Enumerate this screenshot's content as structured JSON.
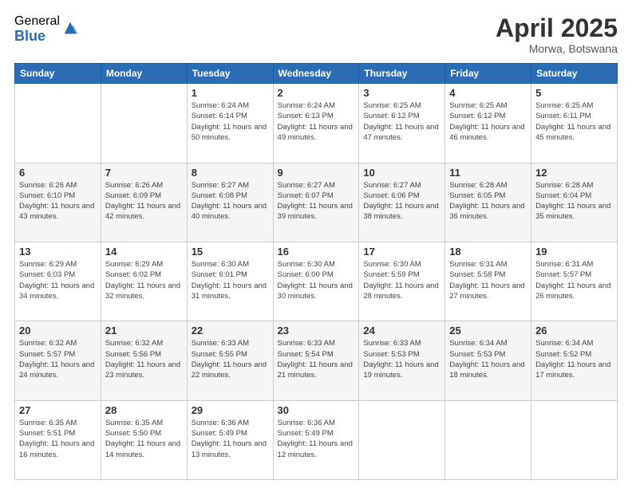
{
  "logo": {
    "general": "General",
    "blue": "Blue"
  },
  "title": "April 2025",
  "location": "Morwa, Botswana",
  "weekdays": [
    "Sunday",
    "Monday",
    "Tuesday",
    "Wednesday",
    "Thursday",
    "Friday",
    "Saturday"
  ],
  "weeks": [
    [
      {
        "day": "",
        "info": ""
      },
      {
        "day": "",
        "info": ""
      },
      {
        "day": "1",
        "info": "Sunrise: 6:24 AM\nSunset: 6:14 PM\nDaylight: 11 hours and 50 minutes."
      },
      {
        "day": "2",
        "info": "Sunrise: 6:24 AM\nSunset: 6:13 PM\nDaylight: 11 hours and 49 minutes."
      },
      {
        "day": "3",
        "info": "Sunrise: 6:25 AM\nSunset: 6:12 PM\nDaylight: 11 hours and 47 minutes."
      },
      {
        "day": "4",
        "info": "Sunrise: 6:25 AM\nSunset: 6:12 PM\nDaylight: 11 hours and 46 minutes."
      },
      {
        "day": "5",
        "info": "Sunrise: 6:25 AM\nSunset: 6:11 PM\nDaylight: 11 hours and 45 minutes."
      }
    ],
    [
      {
        "day": "6",
        "info": "Sunrise: 6:26 AM\nSunset: 6:10 PM\nDaylight: 11 hours and 43 minutes."
      },
      {
        "day": "7",
        "info": "Sunrise: 6:26 AM\nSunset: 6:09 PM\nDaylight: 11 hours and 42 minutes."
      },
      {
        "day": "8",
        "info": "Sunrise: 6:27 AM\nSunset: 6:08 PM\nDaylight: 11 hours and 40 minutes."
      },
      {
        "day": "9",
        "info": "Sunrise: 6:27 AM\nSunset: 6:07 PM\nDaylight: 11 hours and 39 minutes."
      },
      {
        "day": "10",
        "info": "Sunrise: 6:27 AM\nSunset: 6:06 PM\nDaylight: 11 hours and 38 minutes."
      },
      {
        "day": "11",
        "info": "Sunrise: 6:28 AM\nSunset: 6:05 PM\nDaylight: 11 hours and 36 minutes."
      },
      {
        "day": "12",
        "info": "Sunrise: 6:28 AM\nSunset: 6:04 PM\nDaylight: 11 hours and 35 minutes."
      }
    ],
    [
      {
        "day": "13",
        "info": "Sunrise: 6:29 AM\nSunset: 6:03 PM\nDaylight: 11 hours and 34 minutes."
      },
      {
        "day": "14",
        "info": "Sunrise: 6:29 AM\nSunset: 6:02 PM\nDaylight: 11 hours and 32 minutes."
      },
      {
        "day": "15",
        "info": "Sunrise: 6:30 AM\nSunset: 6:01 PM\nDaylight: 11 hours and 31 minutes."
      },
      {
        "day": "16",
        "info": "Sunrise: 6:30 AM\nSunset: 6:00 PM\nDaylight: 11 hours and 30 minutes."
      },
      {
        "day": "17",
        "info": "Sunrise: 6:30 AM\nSunset: 5:59 PM\nDaylight: 11 hours and 28 minutes."
      },
      {
        "day": "18",
        "info": "Sunrise: 6:31 AM\nSunset: 5:58 PM\nDaylight: 11 hours and 27 minutes."
      },
      {
        "day": "19",
        "info": "Sunrise: 6:31 AM\nSunset: 5:57 PM\nDaylight: 11 hours and 26 minutes."
      }
    ],
    [
      {
        "day": "20",
        "info": "Sunrise: 6:32 AM\nSunset: 5:57 PM\nDaylight: 11 hours and 24 minutes."
      },
      {
        "day": "21",
        "info": "Sunrise: 6:32 AM\nSunset: 5:56 PM\nDaylight: 11 hours and 23 minutes."
      },
      {
        "day": "22",
        "info": "Sunrise: 6:33 AM\nSunset: 5:55 PM\nDaylight: 11 hours and 22 minutes."
      },
      {
        "day": "23",
        "info": "Sunrise: 6:33 AM\nSunset: 5:54 PM\nDaylight: 11 hours and 21 minutes."
      },
      {
        "day": "24",
        "info": "Sunrise: 6:33 AM\nSunset: 5:53 PM\nDaylight: 11 hours and 19 minutes."
      },
      {
        "day": "25",
        "info": "Sunrise: 6:34 AM\nSunset: 5:53 PM\nDaylight: 11 hours and 18 minutes."
      },
      {
        "day": "26",
        "info": "Sunrise: 6:34 AM\nSunset: 5:52 PM\nDaylight: 11 hours and 17 minutes."
      }
    ],
    [
      {
        "day": "27",
        "info": "Sunrise: 6:35 AM\nSunset: 5:51 PM\nDaylight: 11 hours and 16 minutes."
      },
      {
        "day": "28",
        "info": "Sunrise: 6:35 AM\nSunset: 5:50 PM\nDaylight: 11 hours and 14 minutes."
      },
      {
        "day": "29",
        "info": "Sunrise: 6:36 AM\nSunset: 5:49 PM\nDaylight: 11 hours and 13 minutes."
      },
      {
        "day": "30",
        "info": "Sunrise: 6:36 AM\nSunset: 5:49 PM\nDaylight: 11 hours and 12 minutes."
      },
      {
        "day": "",
        "info": ""
      },
      {
        "day": "",
        "info": ""
      },
      {
        "day": "",
        "info": ""
      }
    ]
  ]
}
